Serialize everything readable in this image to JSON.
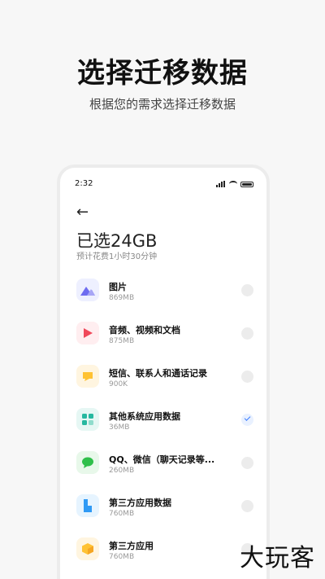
{
  "hero": {
    "title": "选择迁移数据",
    "subtitle": "根据您的需求选择迁移数据"
  },
  "status_bar": {
    "time": "2:32"
  },
  "screen": {
    "selected_text": "已选24GB",
    "estimate_text": "预计花费1小时30分钟"
  },
  "items": [
    {
      "name": "图片",
      "size": "869MB",
      "icon": "image-icon",
      "checked": false
    },
    {
      "name": "音频、视频和文档",
      "size": "875MB",
      "icon": "play-icon",
      "checked": false
    },
    {
      "name": "短信、联系人和通话记录",
      "size": "900K",
      "icon": "message-icon",
      "checked": false
    },
    {
      "name": "其他系统应用数据",
      "size": "36MB",
      "icon": "apps-grid-icon",
      "checked": true
    },
    {
      "name": "QQ、微信（聊天记录等...",
      "size": "260MB",
      "icon": "chat-icon",
      "checked": false
    },
    {
      "name": "第三方应用数据",
      "size": "760MB",
      "icon": "app-data-icon",
      "checked": false
    },
    {
      "name": "第三方应用",
      "size": "760MB",
      "icon": "package-icon",
      "checked": false
    }
  ],
  "watermark": "大玩客"
}
